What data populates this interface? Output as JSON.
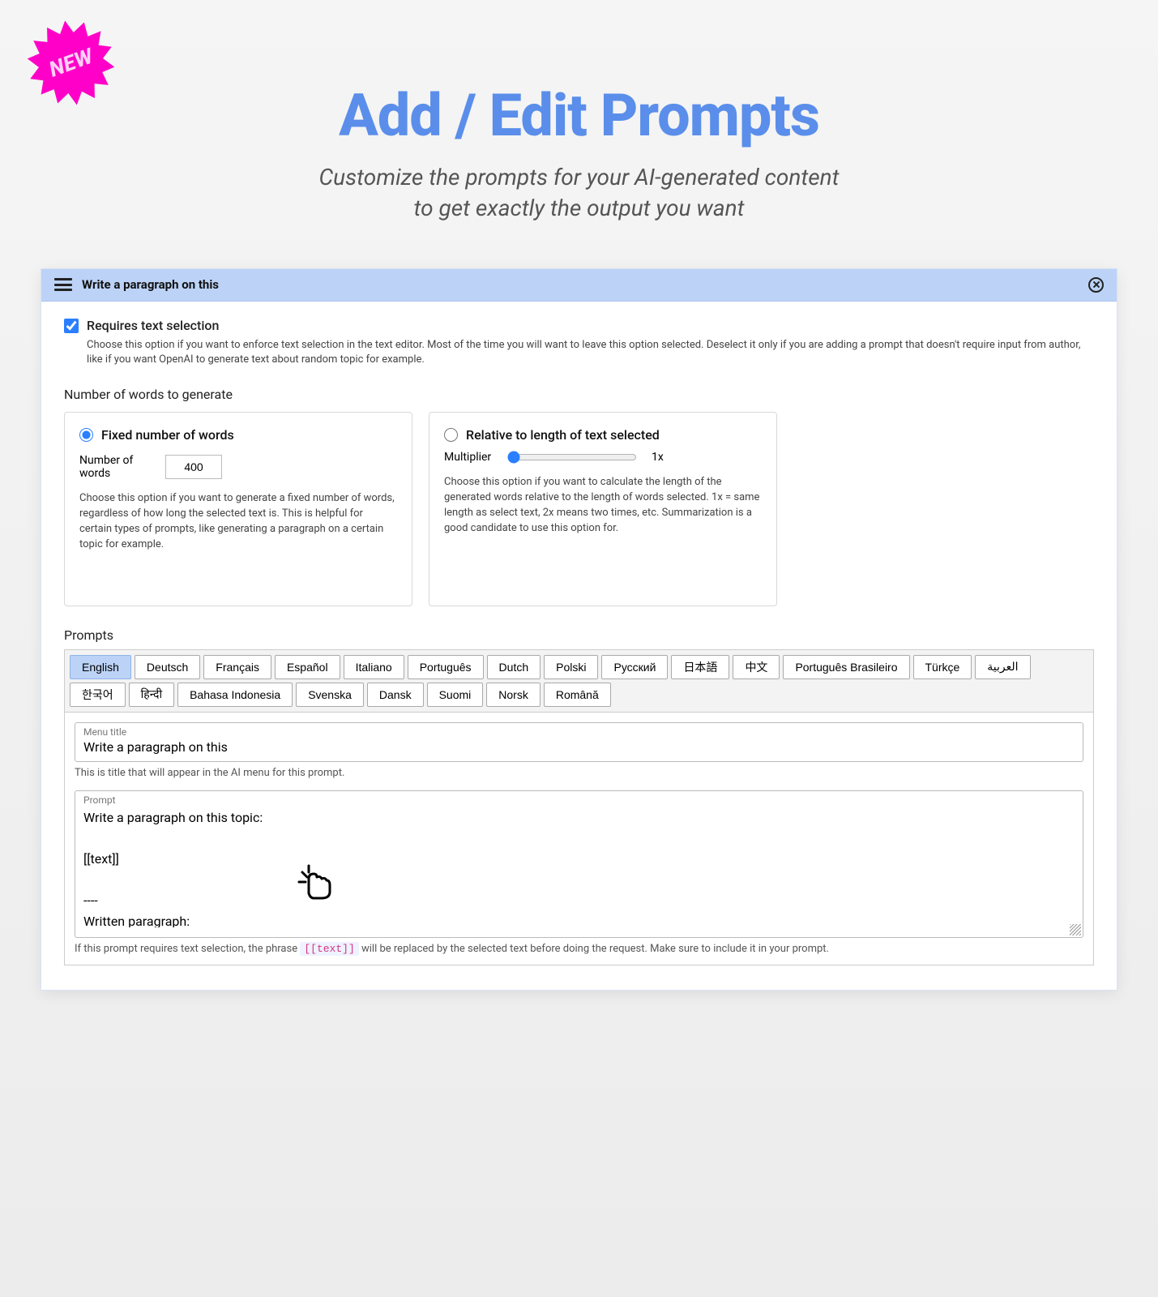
{
  "badge": {
    "text": "NEW"
  },
  "hero": {
    "title": "Add / Edit Prompts",
    "subtitle_line1": "Customize the prompts for your AI-generated content",
    "subtitle_line2": "to get exactly the output you want"
  },
  "panel": {
    "title": "Write a paragraph on this",
    "requires_selection": {
      "label": "Requires text selection",
      "checked": true,
      "help": "Choose this option if you want to enforce text selection in the text editor. Most of the time you will want to leave this option selected. Deselect it only if you are adding a prompt that doesn't require input from author, like if you want OpenAI to generate text about random topic for example."
    },
    "words_section_label": "Number of words to generate",
    "fixed_option": {
      "label": "Fixed number of words",
      "selected": true,
      "field_label": "Number of words",
      "value": "400",
      "help": "Choose this option if you want to generate a fixed number of words, regardless of how long the selected text is. This is helpful for certain types of prompts, like generating a paragraph on a certain topic for example."
    },
    "relative_option": {
      "label": "Relative to length of text selected",
      "selected": false,
      "field_label": "Multiplier",
      "value_display": "1x",
      "help": "Choose this option if you want to calculate the length of the generated words relative to the length of words selected. 1x = same length as select text, 2x means two times, etc. Summarization is a good candidate to use this option for."
    },
    "prompts_label": "Prompts",
    "tabs": [
      "English",
      "Deutsch",
      "Français",
      "Español",
      "Italiano",
      "Português",
      "Dutch",
      "Polski",
      "Русский",
      "日本語",
      "中文",
      "Português Brasileiro",
      "Türkçe",
      "العربية",
      "한국어",
      "हिन्दी",
      "Bahasa Indonesia",
      "Svenska",
      "Dansk",
      "Suomi",
      "Norsk",
      "Română"
    ],
    "active_tab": "English",
    "menu_title_label": "Menu title",
    "menu_title_value": "Write a paragraph on this",
    "menu_title_help": "This is title that will appear in the AI menu for this prompt.",
    "prompt_label": "Prompt",
    "prompt_value": "Write a paragraph on this topic:\n\n[[text]]\n\n----\nWritten paragraph:",
    "token": "[[text]]",
    "prompt_help_before": "If this prompt requires text selection, the phrase ",
    "prompt_help_after": " will be replaced by the selected text before doing the request. Make sure to include it in your prompt."
  }
}
